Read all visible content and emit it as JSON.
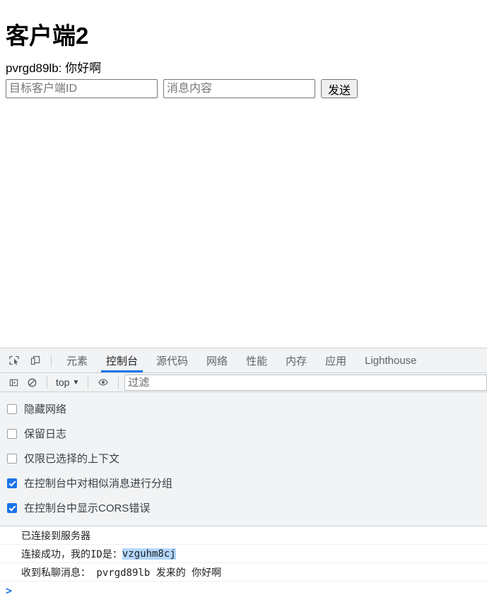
{
  "page": {
    "title": "客户端2",
    "messages": [
      "pvrgd89lb: 你好啊"
    ],
    "composer": {
      "target_id_placeholder": "目标客户端ID",
      "target_id_value": "",
      "message_placeholder": "消息内容",
      "message_value": "",
      "send_label": "发送"
    }
  },
  "devtools": {
    "icons": {
      "inspect": "inspect-element-icon",
      "device": "device-toolbar-icon",
      "console_sidebar": "console-sidebar-icon",
      "clear": "clear-console-icon",
      "eye": "live-expression-eye-icon",
      "chevron": "chevron-down-icon"
    },
    "tabs": [
      {
        "label": "元素",
        "active": false
      },
      {
        "label": "控制台",
        "active": true
      },
      {
        "label": "源代码",
        "active": false
      },
      {
        "label": "网络",
        "active": false
      },
      {
        "label": "性能",
        "active": false
      },
      {
        "label": "内存",
        "active": false
      },
      {
        "label": "应用",
        "active": false
      },
      {
        "label": "Lighthouse",
        "active": false
      }
    ],
    "filterbar": {
      "context_label": "top",
      "chevron": "▼",
      "filter_placeholder": "过滤",
      "filter_value": ""
    },
    "settings": [
      {
        "label": "隐藏网络",
        "checked": false
      },
      {
        "label": "保留日志",
        "checked": false
      },
      {
        "label": "仅限已选择的上下文",
        "checked": false
      },
      {
        "label": "在控制台中对相似消息进行分组",
        "checked": true
      },
      {
        "label": "在控制台中显示CORS错误",
        "checked": true
      }
    ],
    "console": {
      "rows": [
        {
          "text": "已连接到服务器",
          "highlight": ""
        },
        {
          "text": "连接成功，我的ID是： ",
          "highlight": "vzguhm8cj"
        },
        {
          "text": "收到私聊消息： pvrgd89lb 发来的 你好啊",
          "highlight": ""
        }
      ],
      "prompt": ">",
      "prompt_value": ""
    },
    "colors": {
      "accent": "#1a73e8",
      "toolbar_bg": "#f1f3f4",
      "selection": "#b3d7fd"
    }
  }
}
